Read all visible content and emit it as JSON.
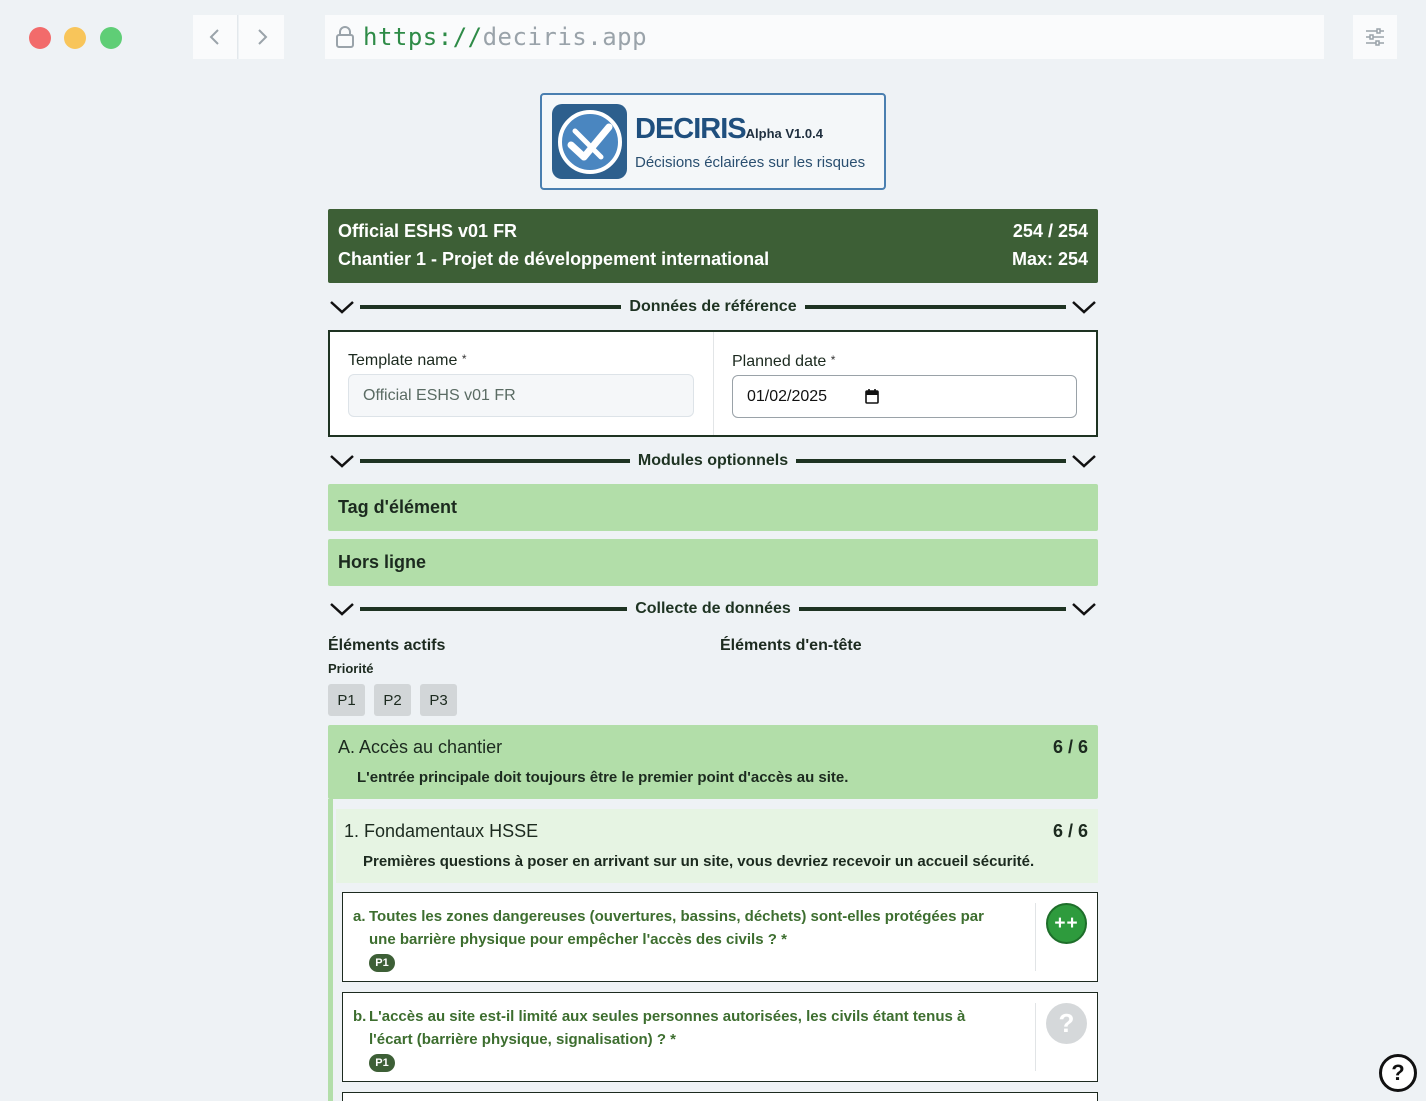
{
  "browser": {
    "url_scheme": "https://",
    "url_host": "deciris.app"
  },
  "logo": {
    "title": "DECIRIS",
    "version": "Alpha V1.0.4",
    "tagline": "Décisions éclairées sur les risques"
  },
  "header": {
    "template_title": "Official ESHS v01 FR",
    "score": "254 / 254",
    "project": "Chantier 1 - Projet de développement international",
    "max": "Max: 254"
  },
  "dividers": {
    "reference": "Données de référence",
    "modules": "Modules optionnels",
    "collection": "Collecte de données"
  },
  "reference": {
    "template_label": "Template name",
    "template_value": "Official ESHS v01 FR",
    "date_label": "Planned date",
    "date_value": "01/02/2025",
    "required_mark": "*"
  },
  "modules": [
    "Tag d'élément",
    "Hors ligne"
  ],
  "collection": {
    "active_label": "Éléments actifs",
    "header_label": "Éléments d'en-tête",
    "priority_label": "Priorité",
    "priorities": [
      "P1",
      "P2",
      "P3"
    ]
  },
  "sectionA": {
    "title": "A. Accès au chantier",
    "score": "6 / 6",
    "description": "L'entrée principale doit toujours être le premier point d'accès au site."
  },
  "section1": {
    "title": "1. Fondamentaux HSSE",
    "score": "6 / 6",
    "description": "Premières questions à poser en arrivant sur un site, vous devriez recevoir un accueil sécurité."
  },
  "questions": [
    {
      "letter": "a.",
      "text": "Toutes les zones dangereuses (ouvertures, bassins, déchets) sont-elles protégées par une barrière physique pour empêcher l'accès des civils ? *",
      "badge": "P1",
      "button": "++",
      "status_color": "#2e9b3d"
    },
    {
      "letter": "b.",
      "text": "L'accès au site est-il limité aux seules personnes autorisées, les civils étant tenus à l'écart (barrière physique, signalisation) ? *",
      "badge": "P1",
      "button": "?",
      "status_color": "#d5d8da"
    }
  ],
  "help": "?"
}
